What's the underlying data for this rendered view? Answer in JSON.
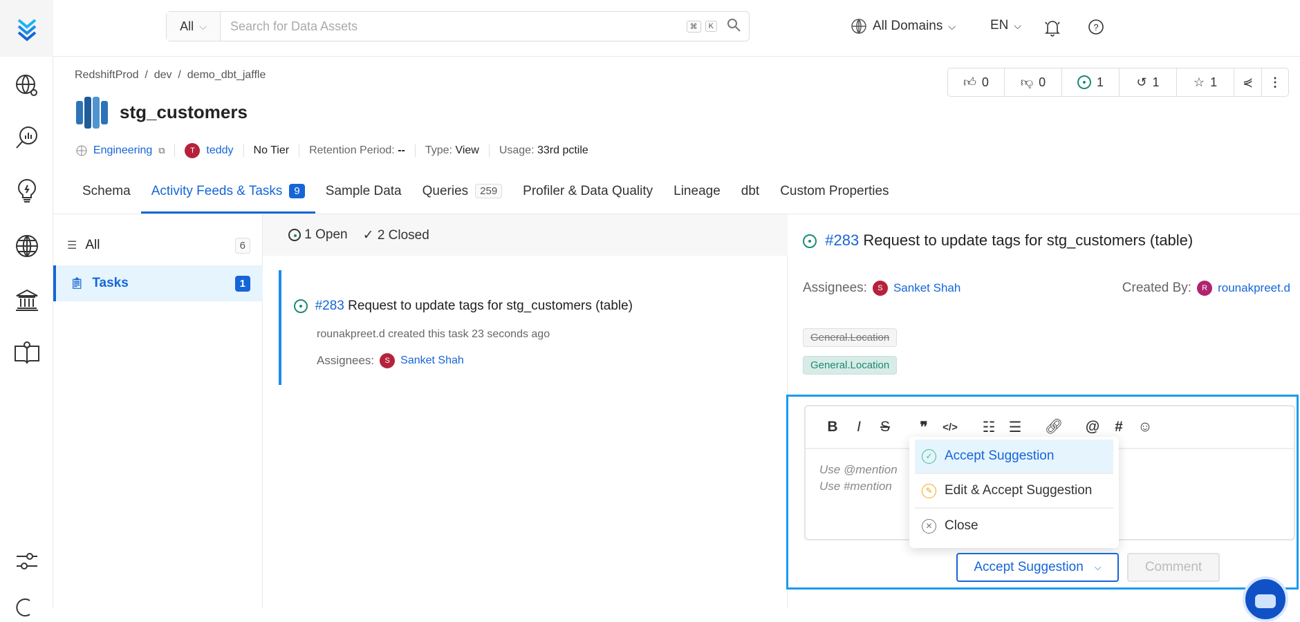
{
  "header": {
    "search_scope": "All",
    "search_placeholder": "Search for Data Assets",
    "kbd_cmd": "⌘",
    "kbd_k": "K",
    "domain": "All Domains",
    "language": "EN"
  },
  "breadcrumb": [
    "RedshiftProd",
    "dev",
    "demo_dbt_jaffle"
  ],
  "entity": {
    "name": "stg_customers",
    "domain": "Engineering",
    "owner": "teddy",
    "owner_initial": "T",
    "tier": "No Tier",
    "retention_label": "Retention Period:",
    "retention_value": "--",
    "type_label": "Type:",
    "type_value": "View",
    "usage_label": "Usage:",
    "usage_value": "33rd pctile"
  },
  "stats": {
    "likes": "0",
    "dislikes": "0",
    "tasks": "1",
    "versions": "1",
    "followers": "1"
  },
  "tabs": [
    {
      "label": "Schema"
    },
    {
      "label": "Activity Feeds & Tasks",
      "count": "9"
    },
    {
      "label": "Sample Data"
    },
    {
      "label": "Queries",
      "count": "259"
    },
    {
      "label": "Profiler & Data Quality"
    },
    {
      "label": "Lineage"
    },
    {
      "label": "dbt"
    },
    {
      "label": "Custom Properties"
    }
  ],
  "filters": [
    {
      "label": "All",
      "count": "6"
    },
    {
      "label": "Tasks",
      "count": "1"
    }
  ],
  "task_list": {
    "open": "1 Open",
    "closed": "2 Closed"
  },
  "task": {
    "id": "#283",
    "title": "Request to update tags for stg_customers (table)",
    "created": "rounakpreet.d created this task 23 seconds ago",
    "assignees_label": "Assignees:",
    "assignee": "Sanket Shah",
    "assignee_initial": "S",
    "created_by_label": "Created By:",
    "creator": "rounakpreet.d",
    "creator_initial": "R",
    "old_tag": "General.Location",
    "new_tag": "General.Location"
  },
  "editor": {
    "placeholder_1": "Use @mention",
    "placeholder_2": "Use #mention"
  },
  "menu": [
    "Accept Suggestion",
    "Edit & Accept Suggestion",
    "Close"
  ],
  "actions": {
    "accept": "Accept Suggestion",
    "comment": "Comment"
  },
  "colors": {
    "accent": "#1565d8",
    "open": "#1b8a73",
    "highlight": "#1a9bf0"
  }
}
